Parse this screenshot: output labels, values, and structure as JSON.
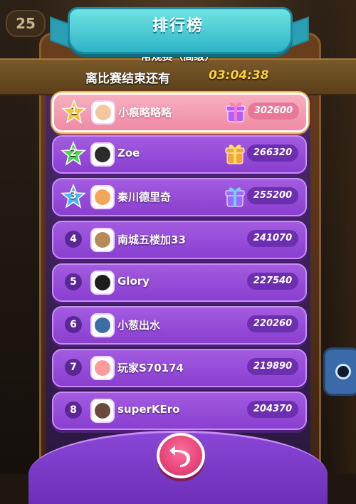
{
  "header": {
    "level_badge": "25",
    "title": "排行榜",
    "subtitle": "常规赛（高级）",
    "timer_label": "离比赛结束还有",
    "timer_value": "03:04:38"
  },
  "leaderboard": {
    "rows": [
      {
        "rank": "1",
        "name": "小痕略略略",
        "score": "302600",
        "medal": "gold",
        "mine": true,
        "gift": "gift-purple"
      },
      {
        "rank": "2",
        "name": "Zoe",
        "score": "266320",
        "medal": "green",
        "mine": false,
        "gift": "gift-orange"
      },
      {
        "rank": "3",
        "name": "秦川德里奇",
        "score": "255200",
        "medal": "blue",
        "mine": false,
        "gift": "gift-blue"
      },
      {
        "rank": "4",
        "name": "南城五楼加33",
        "score": "241070",
        "medal": "",
        "mine": false,
        "gift": ""
      },
      {
        "rank": "5",
        "name": "Glory",
        "score": "227540",
        "medal": "",
        "mine": false,
        "gift": ""
      },
      {
        "rank": "6",
        "name": "小葱出水",
        "score": "220260",
        "medal": "",
        "mine": false,
        "gift": ""
      },
      {
        "rank": "7",
        "name": "玩家S70174",
        "score": "219890",
        "medal": "",
        "mine": false,
        "gift": ""
      },
      {
        "rank": "8",
        "name": "superKEro",
        "score": "204370",
        "medal": "",
        "mine": false,
        "gift": ""
      }
    ]
  },
  "colors": {
    "row_purple": "#9b4fdc",
    "row_mine_pink": "#f49ab2",
    "timer_gold": "#ffd23a",
    "banner_cyan": "#4fd0d8"
  },
  "icons": {
    "back": "back-arrow-icon",
    "gift": "gift-box-icon",
    "star": "rank-star-icon"
  }
}
